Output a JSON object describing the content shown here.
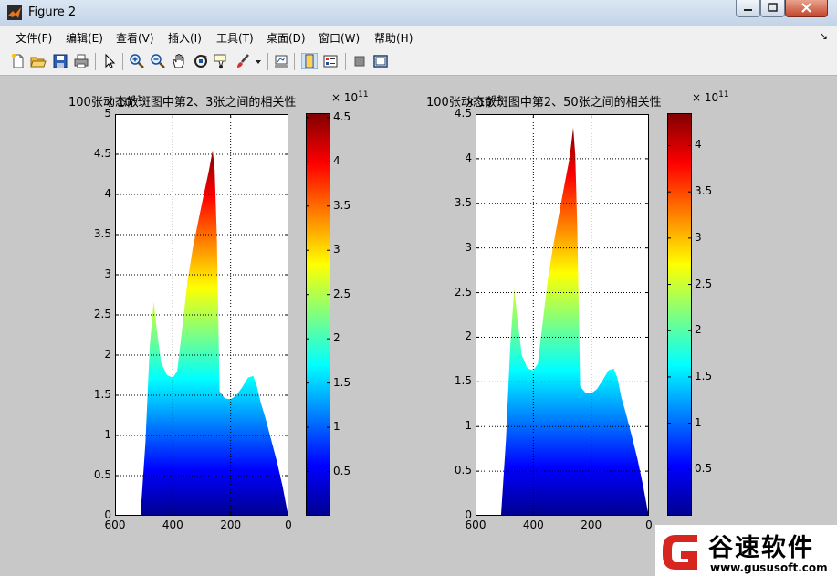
{
  "window": {
    "title": "Figure 2"
  },
  "menu": [
    "文件(F)",
    "编辑(E)",
    "查看(V)",
    "插入(I)",
    "工具(T)",
    "桌面(D)",
    "窗口(W)",
    "帮助(H)"
  ],
  "menu_dock": "↘",
  "toolbar": {
    "icons": [
      "new-figure-icon",
      "open-file-icon",
      "save-icon",
      "print-icon",
      "edit-plot-arrow-icon",
      "zoom-in-icon",
      "zoom-out-icon",
      "pan-hand-icon",
      "rotate-3d-icon",
      "data-cursor-icon",
      "brush-icon",
      "brush-dropdown-icon",
      "link-plot-icon",
      "colorbar-icon",
      "legend-icon",
      "hide-plot-tools-icon",
      "show-plot-tools-icon"
    ]
  },
  "colors": {
    "jet_start": "#00008f",
    "jet_end": "#800000",
    "axes_bg": "#ffffff",
    "figure_bg": "#c8c8c8"
  },
  "chart_data": [
    {
      "type": "area",
      "title": "100张动态散斑图中第2、3张之间的相关性",
      "xlabel": "",
      "ylabel": "",
      "x_reversed": true,
      "xlim": [
        600,
        0
      ],
      "ylim": [
        0,
        5
      ],
      "y_multiplier": "× 10",
      "y_multiplier_exp": "11",
      "x_ticks": [
        "600",
        "400",
        "200",
        "0"
      ],
      "y_ticks": [
        "0",
        "0.5",
        "1",
        "1.5",
        "2",
        "2.5",
        "3",
        "3.5",
        "4",
        "4.5",
        "5"
      ],
      "grid": true,
      "colormap": "jet",
      "x": [
        512,
        495,
        480,
        466,
        455,
        440,
        420,
        400,
        385,
        370,
        350,
        330,
        310,
        290,
        275,
        262,
        255,
        248,
        238,
        220,
        200,
        180,
        160,
        140,
        122,
        110,
        95,
        80,
        60,
        40,
        20,
        5,
        0
      ],
      "y": [
        0,
        0.9,
        2.1,
        2.67,
        2.3,
        1.9,
        1.75,
        1.72,
        1.8,
        2.25,
        2.9,
        3.35,
        3.7,
        4.05,
        4.3,
        4.55,
        4.3,
        3.5,
        1.55,
        1.46,
        1.45,
        1.5,
        1.6,
        1.72,
        1.74,
        1.62,
        1.4,
        1.22,
        0.95,
        0.68,
        0.36,
        0.08,
        0
      ],
      "colorbar": {
        "ticks": [
          "0.5",
          "1",
          "1.5",
          "2",
          "2.5",
          "3",
          "3.5",
          "4",
          "4.5"
        ],
        "multiplier": "× 10",
        "multiplier_exp": "11",
        "range": [
          0,
          4.55
        ]
      }
    },
    {
      "type": "area",
      "title": "100张动态散斑图中第2、50张之间的相关性",
      "xlabel": "",
      "ylabel": "",
      "x_reversed": true,
      "xlim": [
        600,
        0
      ],
      "ylim": [
        0,
        4.5
      ],
      "y_multiplier": "× 10",
      "y_multiplier_exp": "11",
      "x_ticks": [
        "600",
        "400",
        "200",
        "0"
      ],
      "y_ticks": [
        "0",
        "0.5",
        "1",
        "1.5",
        "2",
        "2.5",
        "3",
        "3.5",
        "4",
        "4.5"
      ],
      "grid": true,
      "colormap": "jet",
      "x": [
        512,
        495,
        480,
        466,
        455,
        440,
        420,
        400,
        385,
        370,
        350,
        330,
        310,
        290,
        275,
        262,
        255,
        248,
        238,
        220,
        200,
        180,
        160,
        140,
        122,
        110,
        95,
        80,
        60,
        40,
        20,
        5,
        0
      ],
      "y": [
        0,
        0.85,
        1.9,
        2.55,
        2.2,
        1.8,
        1.65,
        1.63,
        1.7,
        2.1,
        2.65,
        3.05,
        3.4,
        3.75,
        4.0,
        4.35,
        4.05,
        3.2,
        1.45,
        1.38,
        1.37,
        1.42,
        1.52,
        1.63,
        1.65,
        1.55,
        1.32,
        1.15,
        0.9,
        0.64,
        0.33,
        0.07,
        0
      ],
      "colorbar": {
        "ticks": [
          "0.5",
          "1",
          "1.5",
          "2",
          "2.5",
          "3",
          "3.5",
          "4"
        ],
        "multiplier": "× 10",
        "multiplier_exp": "11",
        "range": [
          0,
          4.35
        ]
      }
    }
  ],
  "watermark": {
    "brand": "谷速软件",
    "url": "www.gususoft.com"
  }
}
